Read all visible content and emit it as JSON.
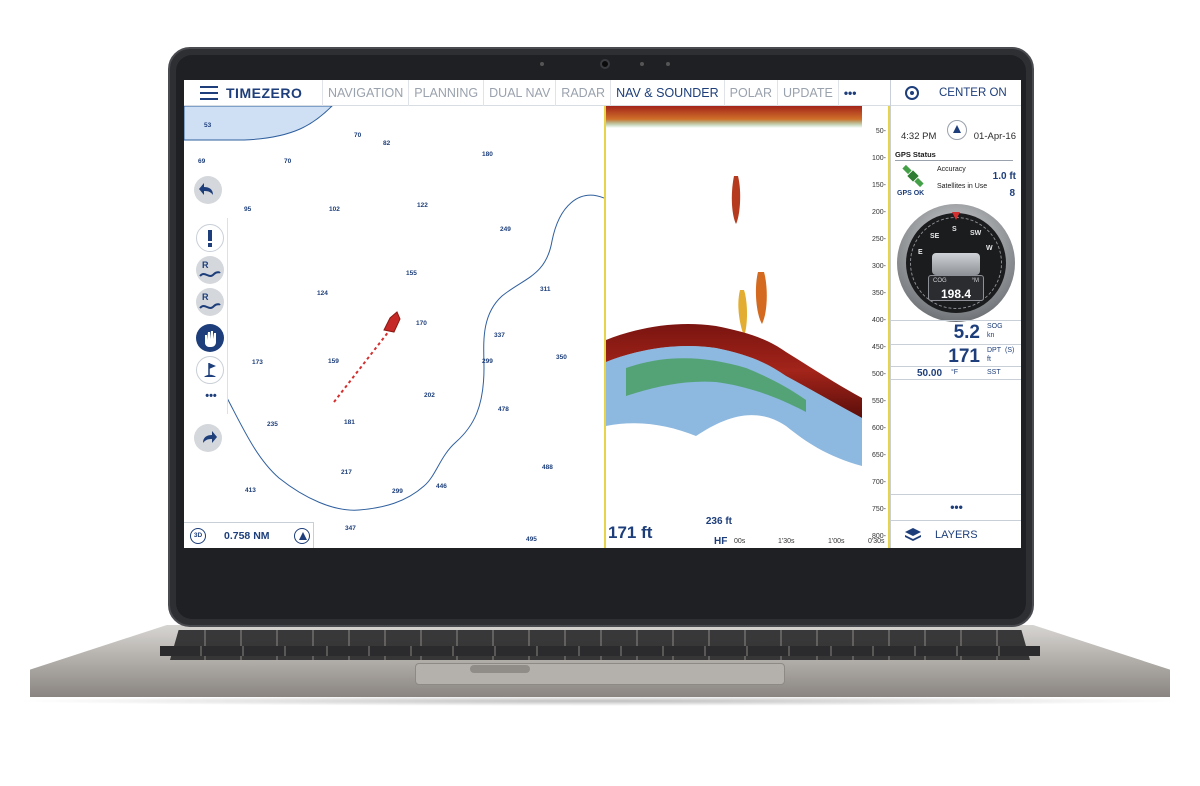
{
  "app": {
    "brand": "TIMEZERO"
  },
  "tabs": [
    {
      "label": "NAVIGATION",
      "active": false
    },
    {
      "label": "PLANNING",
      "active": false
    },
    {
      "label": "DUAL NAV",
      "active": false
    },
    {
      "label": "RADAR",
      "active": false
    },
    {
      "label": "NAV & SOUNDER",
      "active": true
    },
    {
      "label": "POLAR",
      "active": false
    },
    {
      "label": "UPDATE",
      "active": false
    }
  ],
  "tabs_more": "•••",
  "right_panel": {
    "center_on": "CENTER ON",
    "time": "4:32 PM",
    "date": "01-Apr-16",
    "gps": {
      "title": "GPS Status",
      "status": "GPS OK",
      "accuracy_label": "Accuracy",
      "accuracy_value": "1.0 ft",
      "satellites_label": "Satellites in Use",
      "satellites_value": "8"
    },
    "compass": {
      "cog_label": "COG",
      "cog_unit": "°M",
      "cog_value": "198.4",
      "cardinals": [
        "S",
        "SW",
        "W",
        "SE",
        "E"
      ]
    },
    "sog": {
      "value": "5.2",
      "label": "SOG",
      "unit": "kn"
    },
    "dpt": {
      "value": "171",
      "label": "DPT",
      "suffix": "(S)",
      "unit": "ft"
    },
    "sst": {
      "value": "50.00",
      "unit": "°F",
      "label": "SST"
    },
    "more": "•••",
    "layers": "LAYERS"
  },
  "chart": {
    "soundings": [
      "53",
      "70",
      "82",
      "69",
      "70",
      "180",
      "95",
      "102",
      "122",
      "249",
      "155",
      "124",
      "311",
      "170",
      "337",
      "173",
      "159",
      "299",
      "350",
      "202",
      "478",
      "235",
      "181",
      "217",
      "488",
      "413",
      "299",
      "446",
      "347",
      "495"
    ],
    "tool_more": "•••",
    "tool_labels": {
      "route_add": "R+",
      "route_add2": "R+",
      "warning": "!"
    },
    "three_d": "3D",
    "scale": "0.758 NM"
  },
  "sounder": {
    "depth": "171 ft",
    "range": "236 ft",
    "frequency": "HF",
    "depth_ticks": [
      "50-",
      "100-",
      "150-",
      "200-",
      "250-",
      "300-",
      "350-",
      "400-",
      "450-",
      "500-",
      "550-",
      "600-",
      "650-",
      "700-",
      "750-",
      "800-"
    ],
    "time_ticks": [
      "00s",
      "1'30s",
      "1'00s",
      "0'30s"
    ]
  },
  "colors": {
    "navy": "#1d3e7a",
    "echo_red": "#8b1a12",
    "echo_green": "#3a9a4a",
    "echo_blue": "#2f7dc4",
    "echo_yellow": "#e7d44a"
  }
}
